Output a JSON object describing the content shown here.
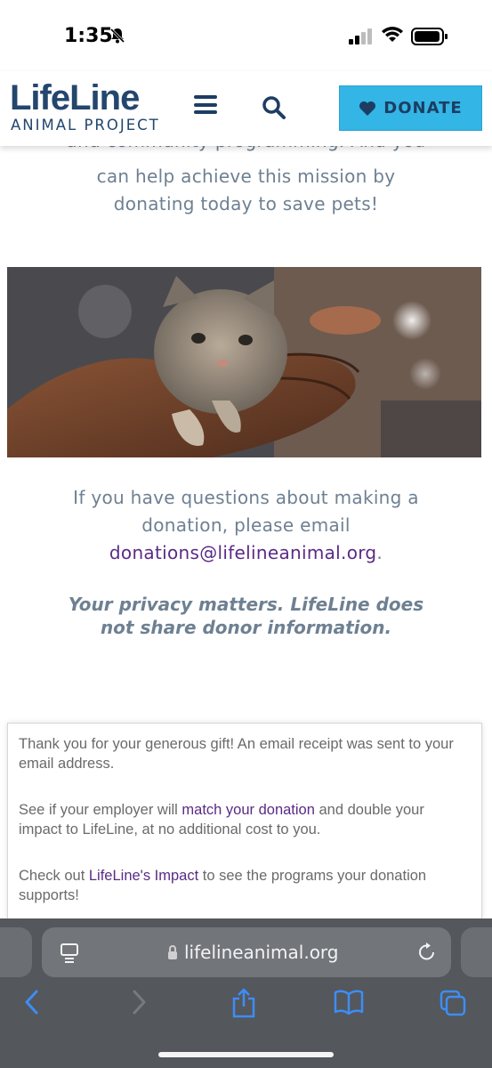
{
  "status_bar": {
    "time": "1:35"
  },
  "header": {
    "logo_main": "LifeLine",
    "logo_sub": "ANIMAL PROJECT",
    "donate_label": "DONATE"
  },
  "content": {
    "partial_line": "and community programming. And you",
    "mission_lines": [
      "can help achieve this mission by",
      "donating today to save pets!"
    ],
    "questions_lines": [
      "If you have questions about making a",
      "donation, please email"
    ],
    "email": "donations@lifelineanimal.org",
    "email_suffix": ".",
    "privacy_lines": [
      "Your privacy matters. LifeLine does",
      "not share donor information."
    ]
  },
  "card": {
    "p1": "Thank you for your generous gift! An email receipt was sent to your email address.",
    "p2_before": "See if your employer will ",
    "p2_link": "match your donation",
    "p2_after": " and double your impact to LifeLine, at no additional cost to you.",
    "p3_link": "LifeLine's Impact",
    "p3_before": "Check out ",
    "p3_after": " to see the programs your donation supports!"
  },
  "browser": {
    "url": "lifelineanimal.org"
  },
  "colors": {
    "brand_navy": "#23466e",
    "donate_blue": "#33b5e5",
    "link_purple": "#5b2a86",
    "body_text": "#6e8092"
  }
}
